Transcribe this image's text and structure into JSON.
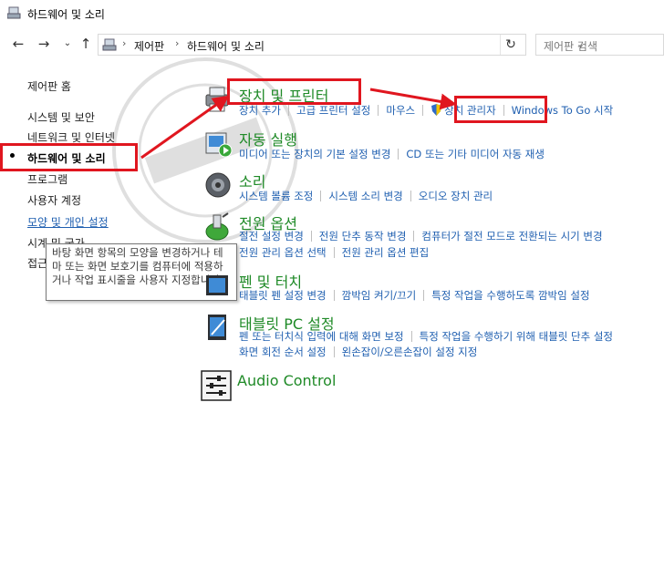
{
  "window": {
    "title": "하드웨어 및 소리"
  },
  "address": {
    "crumbs": [
      "제어판",
      "하드웨어 및 소리"
    ]
  },
  "search": {
    "placeholder": "제어판 검색"
  },
  "sidebar": {
    "home": "제어판 홈",
    "items": [
      "시스템 및 보안",
      "네트워크 및 인터넷",
      "하드웨어 및 소리",
      "프로그램",
      "사용자 계정",
      "모양 및 개인 설정",
      "시계 및 국가",
      "접근성"
    ],
    "active_index": 2
  },
  "tooltip": {
    "text": "바탕 화면 항목의 모양을 변경하거나 테마 또는 화면 보호기를 컴퓨터에 적용하거나 작업 표시줄을 사용자 지정합니다."
  },
  "categories": [
    {
      "title": "장치 및 프린터",
      "icon": "printer-icon",
      "links": [
        "장치 추가",
        "고급 프린터 설정",
        "마우스",
        "장치 관리자",
        "Windows To Go 시작"
      ]
    },
    {
      "title": "자동 실행",
      "icon": "autoplay-icon",
      "links": [
        "미디어 또는 장치의 기본 설정 변경",
        "CD 또는 기타 미디어 자동 재생"
      ]
    },
    {
      "title": "소리",
      "icon": "speaker-icon",
      "links": [
        "시스템 볼륨 조정",
        "시스템 소리 변경",
        "오디오 장치 관리"
      ]
    },
    {
      "title": "전원 옵션",
      "icon": "battery-icon",
      "links": [
        "절전 설정 변경",
        "전원 단추 동작 변경",
        "컴퓨터가 절전 모드로 전환되는 시기 변경",
        "전원 관리 옵션 선택",
        "전원 관리 옵션 편집"
      ]
    },
    {
      "title": "펜 및 터치",
      "icon": "pen-icon",
      "links": [
        "태블릿 펜 설정 변경",
        "깜박임 켜기/끄기",
        "특정 작업을 수행하도록 깜박임 설정"
      ]
    },
    {
      "title": "태블릿 PC 설정",
      "icon": "tablet-icon",
      "links": [
        "펜 또는 터치식 입력에 대해 화면 보정",
        "특정 작업을 수행하기 위해 태블릿 단추 설정",
        "화면 회전 순서 설정",
        "왼손잡이/오른손잡이 설정 지정"
      ]
    },
    {
      "title": "Audio Control",
      "icon": "sliders-icon",
      "links": []
    }
  ],
  "colors": {
    "category_green": "#1f8a27",
    "link_blue": "#1f5fb0",
    "annotation_red": "#e0161f"
  }
}
